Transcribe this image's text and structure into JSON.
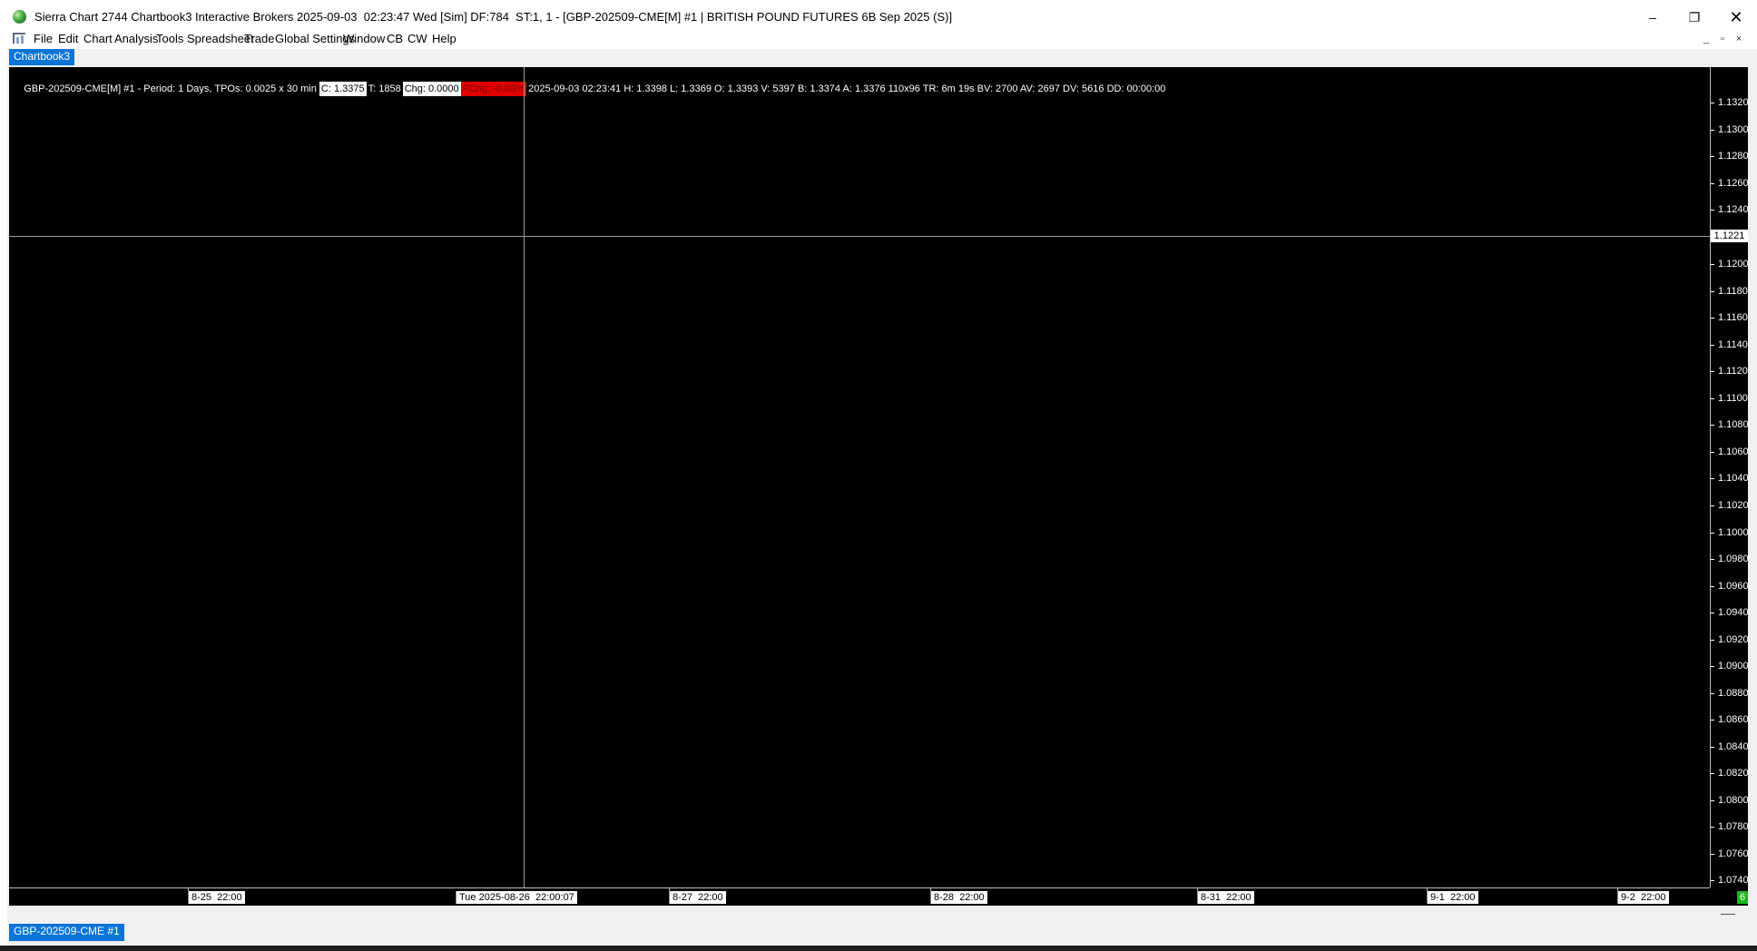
{
  "window": {
    "title": "Sierra Chart 2744 Chartbook3 Interactive Brokers 2025-09-03  02:23:47 Wed [Sim] DF:784  ST:1, 1 - [GBP-202509-CME[M] #1 | BRITISH POUND FUTURES 6B Sep 2025 (S)]",
    "min_glyph": "–",
    "max_glyph": "❐",
    "close_glyph": "✕"
  },
  "menu": {
    "items": [
      "File",
      "Edit",
      "Chart",
      "Analysis",
      "Tools",
      "Spreadsheet",
      "Trade",
      "Global Settings",
      "Window",
      "CB",
      "CW",
      "Help"
    ],
    "mdi_min": "_",
    "mdi_restore": "▫",
    "mdi_close": "×"
  },
  "chartbook_tab": "Chartbook3",
  "info": {
    "prefix": "GBP-202509-CME[M] #1 - Period: 1 Days, TPOs: 0.0025 x 30 min ",
    "close": "C: 1.3375",
    "trades": "T: 1858",
    "chg": "Chg: 0.0000",
    "pchg": "PChg: -0.03%",
    "rest": "2025-09-03 02:23:41 H: 1.3398 L: 1.3369 O: 1.3393 V: 5397 B: 1.3374 A: 1.3376 110x96 TR: 6m 19s BV: 2700 AV: 2697 DV: 5616 DD: 00:00:00"
  },
  "y_axis": {
    "labels": [
      "1.1320",
      "1.1300",
      "1.1280",
      "1.1260",
      "1.1240",
      "1.1200",
      "1.1180",
      "1.1160",
      "1.1140",
      "1.1120",
      "1.1100",
      "1.1080",
      "1.1060",
      "1.1040",
      "1.1020",
      "1.1000",
      "1.0980",
      "1.0960",
      "1.0940",
      "1.0920",
      "1.0900",
      "1.0880",
      "1.0860",
      "1.0840",
      "1.0820",
      "1.0800",
      "1.0780",
      "1.0760",
      "1.0740"
    ],
    "cursor_value": "1.1221"
  },
  "x_axis": {
    "labels": [
      "8-25  22:00",
      "8-27  22:00",
      "8-28  22:00",
      "8-31  22:00",
      "9-1  22:00",
      "9-2  22:00"
    ],
    "cursor_label": "Tue 2025-08-26  22:00:07",
    "corner": "6"
  },
  "bottom_tab": "GBP-202509-CME #1",
  "colors": {
    "accent": "#0a74d8",
    "chart_bg": "#000000",
    "negative": "#e00000",
    "positive": "#1fb51f"
  }
}
